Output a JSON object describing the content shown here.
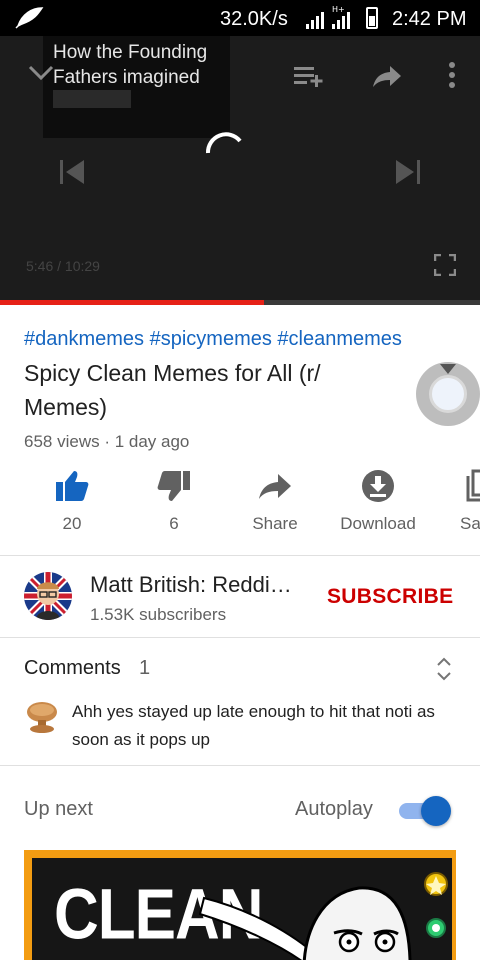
{
  "status_bar": {
    "network_speed": "32.0K/s",
    "time": "2:42 PM"
  },
  "player": {
    "overlay_title": "How the Founding Fathers imagined",
    "timecode": "5:46 / 10:29",
    "progress_fraction": 0.55
  },
  "video": {
    "hashtags": "#dankmemes #spicymemes #cleanmemes",
    "title": "Spicy Clean Memes for All (r/ Memes)",
    "meta": "658 views · 1 day ago"
  },
  "actions": [
    {
      "label": "20",
      "icon": "thumb-up-icon"
    },
    {
      "label": "6",
      "icon": "thumb-down-icon"
    },
    {
      "label": "Share",
      "icon": "share-icon"
    },
    {
      "label": "Download",
      "icon": "download-icon"
    },
    {
      "label": "Sa",
      "icon": "save-playlist-icon"
    }
  ],
  "channel": {
    "name": "Matt British: Reddi…",
    "subscribers": "1.53K subscribers",
    "subscribe_label": "SUBSCRIBE"
  },
  "comments": {
    "label": "Comments",
    "count": "1",
    "top_comment": "Ahh yes stayed up late enough to hit that noti as soon as it pops up"
  },
  "up_next": {
    "label": "Up next",
    "autoplay_label": "Autoplay",
    "autoplay_on": true,
    "thumbnail_text": "CLEAN"
  },
  "colors": {
    "accent_blue": "#1565c0",
    "subscribe_red": "#cc0000",
    "progress_red": "#e62117",
    "thumb_orange": "#f39c12"
  }
}
